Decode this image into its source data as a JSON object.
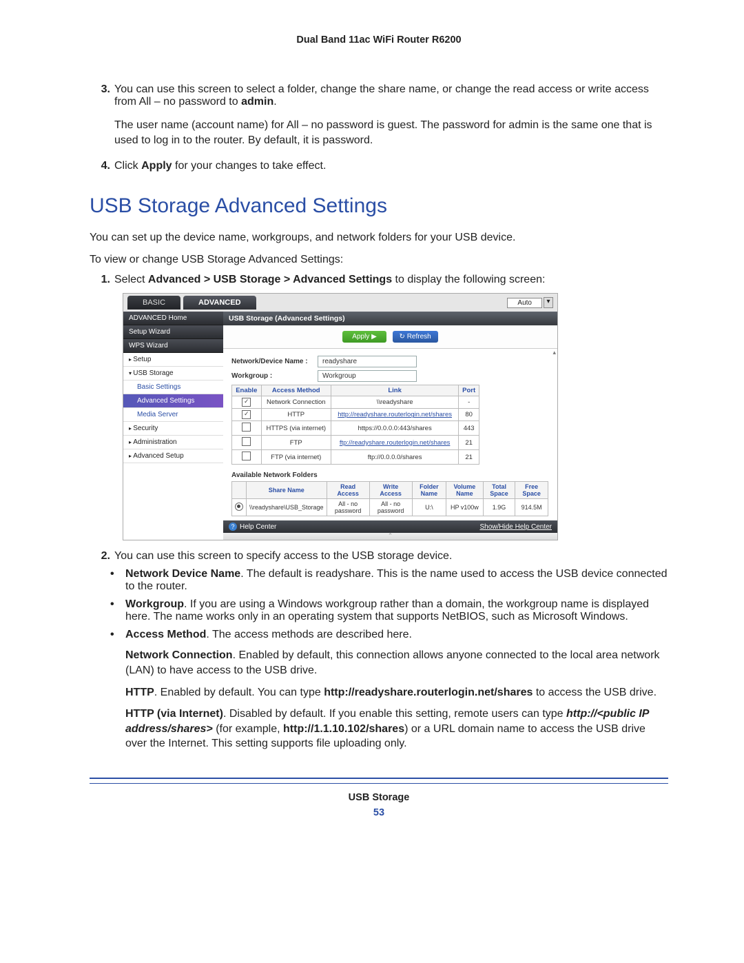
{
  "header": {
    "title": "Dual Band 11ac WiFi Router R6200"
  },
  "footer": {
    "title": "USB Storage",
    "page": "53"
  },
  "section_heading": "USB Storage Advanced Settings",
  "intro_p": "You can set up the device name, workgroups, and network folders for your USB device.",
  "intro_p2": "To view or change USB Storage Advanced Settings:",
  "step3_a": "You can use this screen to select a folder, change the share name, or change the read access or write access from All – no password to ",
  "step3_b": "admin",
  "step3_c": ".",
  "step3_p2": "The user name (account name) for All – no password is guest. The password for admin is the same one that is used to log in to the router. By default, it is password.",
  "step4_a": "Click ",
  "step4_b": "Apply",
  "step4_c": " for your changes to take effect.",
  "step1_a": "Select ",
  "step1_b": "Advanced > USB Storage > Advanced Settings",
  "step1_c": " to display the following screen:",
  "step2_txt": "You can use this screen to specify access to the USB storage device.",
  "bul_ndn_t": "Network Device Name",
  "bul_ndn": ". The default is readyshare. This is the name used to access the USB device connected to the router.",
  "bul_wg_t": "Workgroup",
  "bul_wg": ". If you are using a Windows workgroup rather than a domain, the workgroup name is displayed here. The name works only in an operating system that supports NetBIOS, such as Microsoft Windows.",
  "bul_am_t": "Access Method",
  "bul_am": ". The access methods are described here.",
  "am_nc_t": "Network Connection",
  "am_nc": ". Enabled by default, this connection allows anyone connected to the local area network (LAN) to have access to the USB drive.",
  "am_http_t": "HTTP",
  "am_http_a": ". Enabled by default. You can type ",
  "am_http_b": "http://readyshare.routerlogin.net/shares",
  "am_http_c": " to access the USB drive.",
  "am_httpi_t": "HTTP (via Internet)",
  "am_httpi_a": ". Disabled by default. If you enable this setting, remote users can type ",
  "am_httpi_b": "http://<public IP address/shares>",
  "am_httpi_c": " (for example, ",
  "am_httpi_d": "http://1.1.10.102/shares",
  "am_httpi_e": ") or a URL domain name to access the USB drive over the Internet. This setting supports file uploading only.",
  "ui": {
    "tabs": {
      "basic": "BASIC",
      "advanced": "ADVANCED",
      "auto": "Auto",
      "dd": "▾"
    },
    "sidebar": {
      "adv_home": "ADVANCED Home",
      "setup_wiz": "Setup Wizard",
      "wps_wiz": "WPS Wizard",
      "setup": "Setup",
      "usb": "USB Storage",
      "basic_settings": "Basic Settings",
      "advanced_settings": "Advanced Settings",
      "media_server": "Media Server",
      "security": "Security",
      "administration": "Administration",
      "adv_setup": "Advanced Setup"
    },
    "panel_title": "USB Storage (Advanced Settings)",
    "apply": "Apply ▶",
    "refresh": "↻ Refresh",
    "ndn_label": "Network/Device Name :",
    "ndn_val": "readyshare",
    "wg_label": "Workgroup :",
    "wg_val": "Workgroup",
    "am": {
      "h_enable": "Enable",
      "h_method": "Access Method",
      "h_link": "Link",
      "h_port": "Port",
      "rows": [
        {
          "ck": true,
          "method": "Network Connection",
          "link": "\\\\readyshare",
          "port": "-",
          "is_link": false
        },
        {
          "ck": true,
          "method": "HTTP",
          "link": "http://readyshare.routerlogin.net/shares",
          "port": "80",
          "is_link": true
        },
        {
          "ck": false,
          "method": "HTTPS (via internet)",
          "link": "https://0.0.0.0:443/shares",
          "port": "443",
          "is_link": false
        },
        {
          "ck": false,
          "method": "FTP",
          "link": "ftp://readyshare.routerlogin.net/shares",
          "port": "21",
          "is_link": true
        },
        {
          "ck": false,
          "method": "FTP (via internet)",
          "link": "ftp://0.0.0.0/shares",
          "port": "21",
          "is_link": false
        }
      ]
    },
    "anf_title": "Available Network Folders",
    "anf": {
      "h_share": "Share Name",
      "h_read": "Read Access",
      "h_write": "Write Access",
      "h_folder": "Folder Name",
      "h_vol": "Volume Name",
      "h_total": "Total Space",
      "h_free": "Free Space",
      "row": {
        "share": "\\\\readyshare\\USB_Storage",
        "read": "All - no password",
        "write": "All - no password",
        "folder": "U:\\",
        "vol": "HP v100w",
        "total": "1.9G",
        "free": "914.5M"
      }
    },
    "help_center": "Help Center",
    "show_hide": "Show/Hide Help Center"
  }
}
